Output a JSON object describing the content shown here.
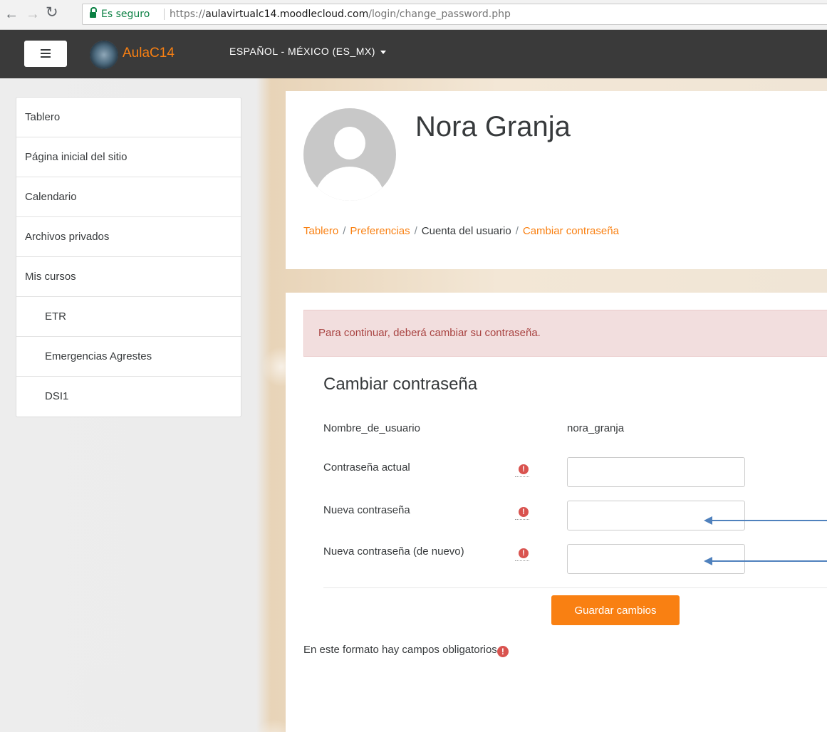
{
  "browser": {
    "secure_label": "Es seguro",
    "url_scheme": "https://",
    "url_host": "aulavirtualc14.moodlecloud.com",
    "url_path": "/login/change_password.php"
  },
  "navbar": {
    "brand": "AulaC14",
    "language": "ESPAÑOL - MÉXICO (ES_MX)"
  },
  "sidebar": {
    "items": [
      {
        "label": "Tablero"
      },
      {
        "label": "Página inicial del sitio"
      },
      {
        "label": "Calendario"
      },
      {
        "label": "Archivos privados"
      },
      {
        "label": "Mis cursos"
      },
      {
        "label": "ETR"
      },
      {
        "label": "Emergencias Agrestes"
      },
      {
        "label": "DSI1"
      }
    ]
  },
  "header": {
    "user_name": "Nora Granja",
    "breadcrumb": [
      "Tablero",
      "Preferencias",
      "Cuenta del usuario",
      "Cambiar contraseña"
    ]
  },
  "form": {
    "alert": "Para continuar, deberá cambiar su contraseña.",
    "title": "Cambiar contraseña",
    "username_label": "Nombre_de_usuario",
    "username_value": "nora_granja",
    "current_password_label": "Contraseña actual",
    "new_password_label": "Nueva contraseña",
    "new_password_again_label": "Nueva contraseña (de nuevo)",
    "required_icon": "!",
    "save_label": "Guardar cambios",
    "required_note": "En este formato hay campos obligatorios"
  },
  "colors": {
    "accent": "#f98012",
    "navbar": "#3a3a3a",
    "alert_bg": "#f2dede",
    "alert_text": "#a94442",
    "required": "#d9534f",
    "annotation_arrow": "#4f81bd"
  }
}
